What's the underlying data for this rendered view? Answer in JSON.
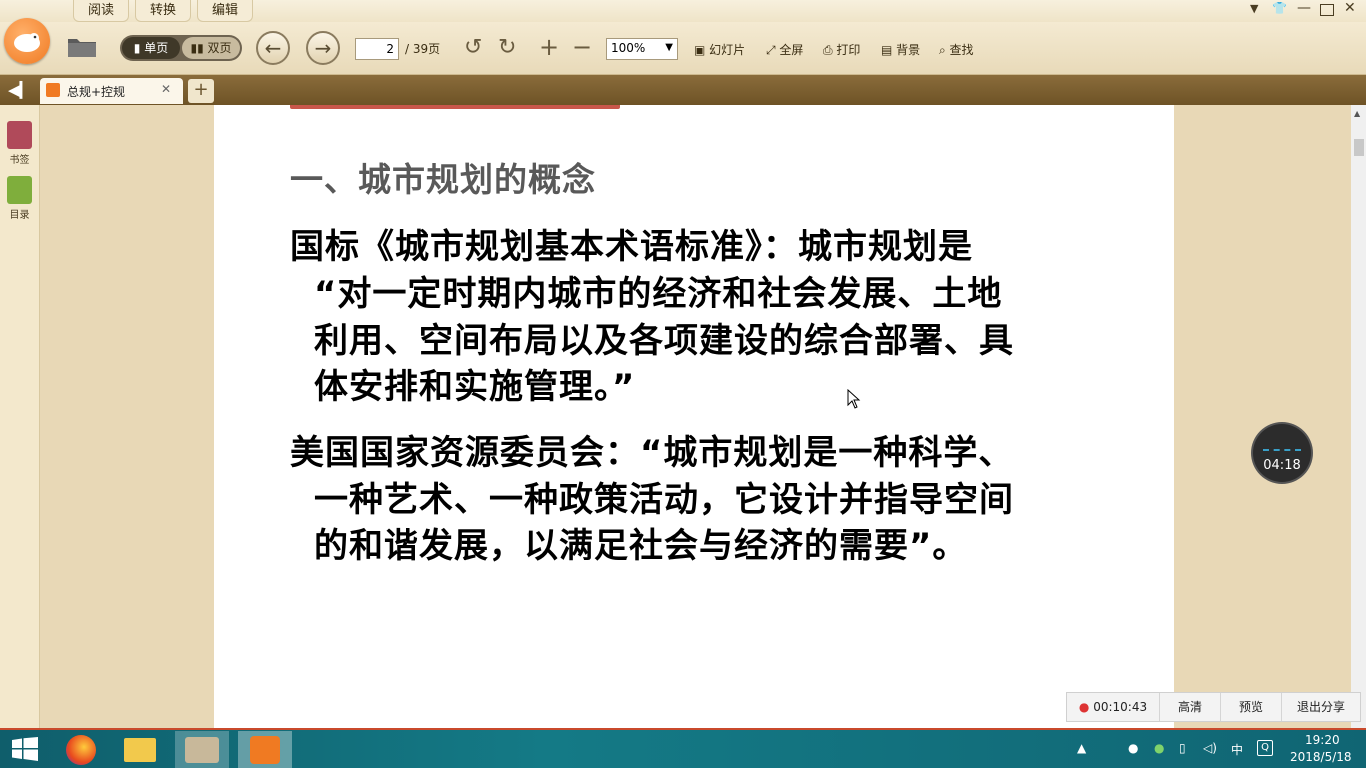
{
  "menu": {
    "tabs": [
      {
        "label": "阅读"
      },
      {
        "label": "转换"
      },
      {
        "label": "编辑"
      }
    ]
  },
  "toolbar": {
    "single_page": "单页",
    "double_page": "双页",
    "current_page": "2",
    "total_pages": "/ 39页",
    "zoom": "100%",
    "slideshow": "幻灯片",
    "fullscreen": "全屏",
    "print": "打印",
    "background": "背景",
    "find": "查找"
  },
  "tabs": {
    "document_tab": "总规+控规",
    "new_tab": "+"
  },
  "sidebar": {
    "bookmark": "书签",
    "toc": "目录"
  },
  "document": {
    "heading": "一、城市规划的概念",
    "paragraph1": [
      "国标《城市规划基本术语标准》：城市规划是",
      "“对一定时期内城市的经济和社会发展、土地",
      "利用、空间布局以及各项建设的综合部署、具",
      "体安排和实施管理。”"
    ],
    "paragraph2": [
      "美国国家资源委员会：“城市规划是一种科学、",
      "一种艺术、一种政策活动，它设计并指导空间",
      "的和谐发展，以满足社会与经济的需要”。"
    ]
  },
  "timer": {
    "value": "04:18"
  },
  "recording": {
    "elapsed": "00:10:43",
    "quality": "高清",
    "preview": "预览",
    "exit_share": "退出分享"
  },
  "taskbar": {
    "clock_time": "19:20",
    "clock_date": "2018/5/18",
    "ime": "中"
  }
}
